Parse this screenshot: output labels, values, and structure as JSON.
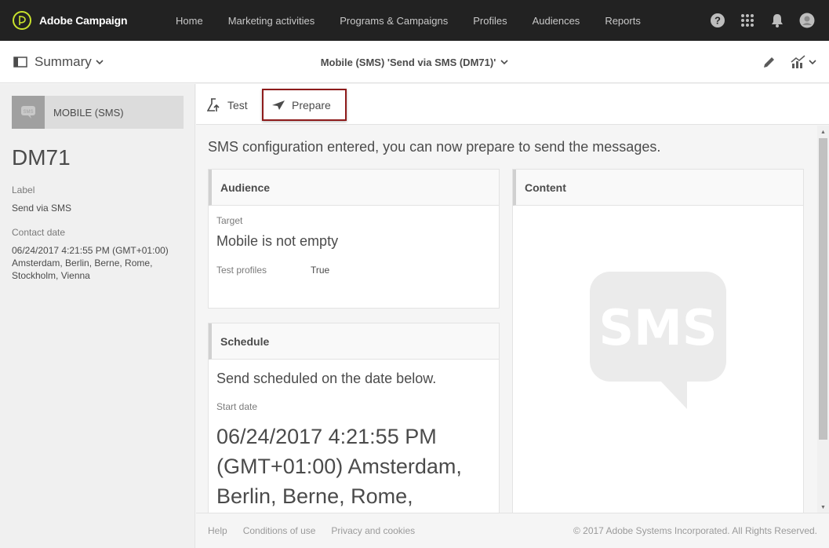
{
  "app": {
    "name": "Adobe Campaign"
  },
  "nav": {
    "items": [
      "Home",
      "Marketing activities",
      "Programs & Campaigns",
      "Profiles",
      "Audiences",
      "Reports"
    ]
  },
  "topbar_icons": [
    "help-icon",
    "apps-grid-icon",
    "bell-icon",
    "user-avatar-icon"
  ],
  "subheader": {
    "summary_label": "Summary",
    "title": "Mobile (SMS) 'Send via SMS (DM71)'"
  },
  "left": {
    "channel": "MOBILE (SMS)",
    "channel_icon_text": "SMS",
    "code": "DM71",
    "label_title": "Label",
    "label_value": "Send via SMS",
    "contact_title": "Contact date",
    "contact_value": "06/24/2017 4:21:55 PM (GMT+01:00) Amsterdam, Berlin, Berne, Rome, Stockholm, Vienna"
  },
  "toolbar": {
    "test_label": "Test",
    "prepare_label": "Prepare"
  },
  "main": {
    "intro": "SMS configuration entered, you can now prepare to send the messages.",
    "audience": {
      "title": "Audience",
      "target_label": "Target",
      "target_value": "Mobile is not empty",
      "test_profiles_label": "Test profiles",
      "test_profiles_value": "True"
    },
    "schedule": {
      "title": "Schedule",
      "description": "Send scheduled on the date below.",
      "start_label": "Start date",
      "start_value": "06/24/2017 4:21:55 PM (GMT+01:00) Amsterdam, Berlin, Berne, Rome,"
    },
    "content": {
      "title": "Content",
      "sms_text": "SMS"
    }
  },
  "footer": {
    "links": [
      "Help",
      "Conditions of use",
      "Privacy and cookies"
    ],
    "copyright": "© 2017 Adobe Systems Incorporated. All Rights Reserved."
  },
  "colors": {
    "topbar": "#222222",
    "accent": "#c9e22c",
    "highlight_border": "#8e1b1b"
  }
}
